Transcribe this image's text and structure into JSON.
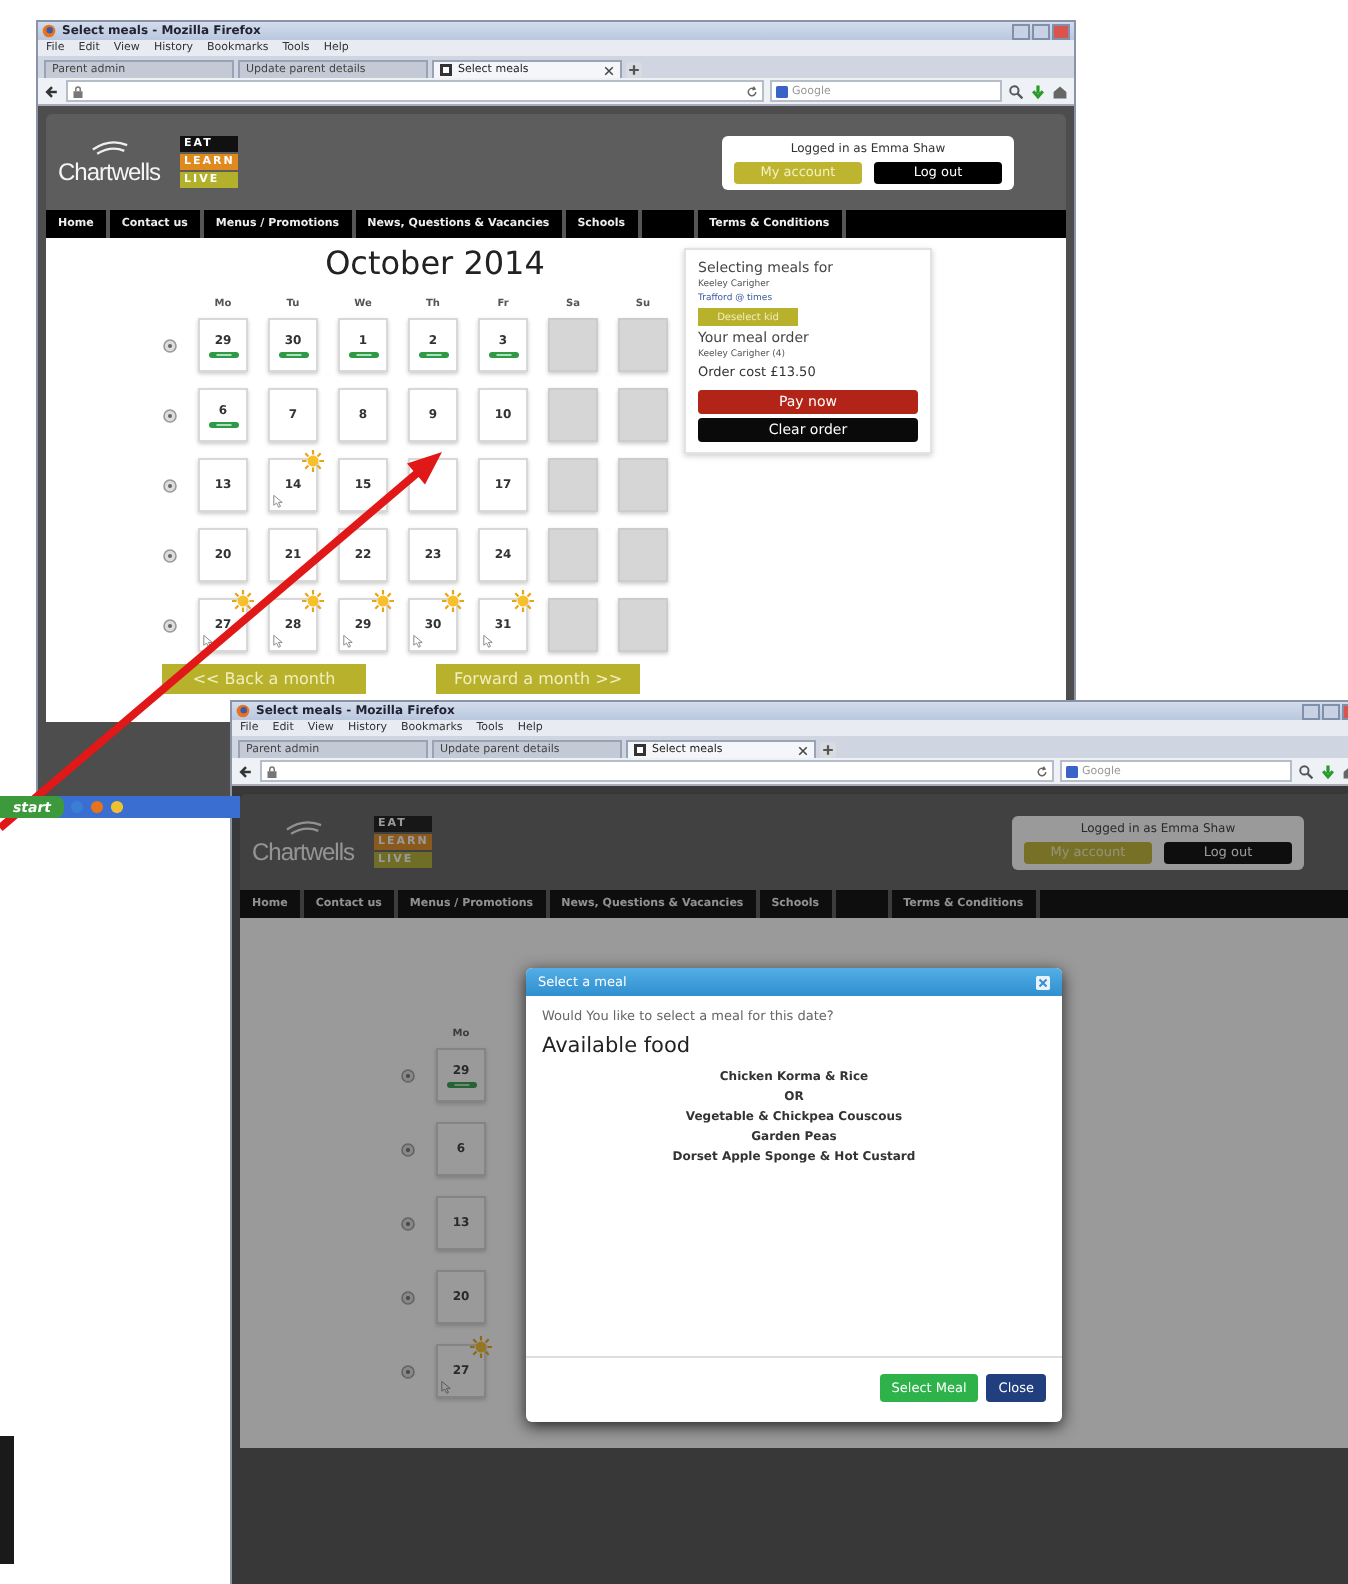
{
  "window_1": {
    "title": "Select meals - Mozilla Firefox",
    "menu": [
      "File",
      "Edit",
      "View",
      "History",
      "Bookmarks",
      "Tools",
      "Help"
    ],
    "tabs": [
      {
        "label": "Parent admin",
        "selected": false
      },
      {
        "label": "Update parent details",
        "selected": false
      },
      {
        "label": "Select meals",
        "selected": true
      }
    ],
    "search": {
      "placeholder": "Google"
    },
    "page": {
      "logo": "Chartwells",
      "tagline": [
        "EAT",
        "LEARN",
        "LIVE"
      ],
      "login": {
        "status": "Logged in as Emma Shaw",
        "buttons": [
          "My account",
          "Log out"
        ]
      },
      "nav": [
        "Home",
        "Contact us",
        "Menus / Promotions",
        "News, Questions & Vacancies",
        "Schools",
        "Terms & Conditions"
      ],
      "calendar": {
        "title": "October 2014",
        "weekdays": [
          "Mo",
          "Tu",
          "We",
          "Th",
          "Fr",
          "Sa",
          "Su"
        ],
        "weeks": [
          {
            "days": [
              {
                "day": "29",
                "kind": "ordered"
              },
              {
                "day": "30",
                "kind": "ordered"
              },
              {
                "day": "1",
                "kind": "ordered"
              },
              {
                "day": "2",
                "kind": "ordered"
              },
              {
                "day": "3",
                "kind": "ordered"
              },
              {
                "kind": "closed"
              },
              {
                "kind": "closed"
              }
            ]
          },
          {
            "days": [
              {
                "day": "6",
                "kind": "ordered"
              },
              {
                "day": "7",
                "kind": "open"
              },
              {
                "day": "8",
                "kind": "open"
              },
              {
                "day": "9",
                "kind": "open"
              },
              {
                "day": "10",
                "kind": "open"
              },
              {
                "kind": "closed"
              },
              {
                "kind": "closed"
              }
            ]
          },
          {
            "days": [
              {
                "day": "13",
                "kind": "open"
              },
              {
                "day": "14",
                "kind": "available"
              },
              {
                "day": "15",
                "kind": "open"
              },
              {
                "kind": "hidden"
              },
              {
                "day": "17",
                "kind": "open"
              },
              {
                "kind": "closed"
              },
              {
                "kind": "closed"
              }
            ]
          },
          {
            "days": [
              {
                "day": "20",
                "kind": "open"
              },
              {
                "day": "21",
                "kind": "open"
              },
              {
                "day": "22",
                "kind": "open"
              },
              {
                "day": "23",
                "kind": "open"
              },
              {
                "day": "24",
                "kind": "open"
              },
              {
                "kind": "closed"
              },
              {
                "kind": "closed"
              }
            ]
          },
          {
            "days": [
              {
                "day": "27",
                "kind": "available"
              },
              {
                "day": "28",
                "kind": "available"
              },
              {
                "day": "29",
                "kind": "available"
              },
              {
                "day": "30",
                "kind": "available"
              },
              {
                "day": "31",
                "kind": "available"
              },
              {
                "kind": "closed"
              },
              {
                "kind": "closed"
              }
            ]
          }
        ],
        "back": "<< Back a month",
        "forward": "Forward a month >>"
      },
      "sidebar": {
        "heading": "Selecting meals for",
        "child": "Keeley Carigher",
        "school": "Trafford @ times",
        "change": "Deselect kid",
        "order_heading": "Your meal order",
        "order_line": "Keeley Carigher (4)",
        "cost": "Order cost £13.50",
        "pay": "Pay now",
        "clear": "Clear order"
      }
    }
  },
  "taskbar": {
    "start": "start"
  },
  "window_2": {
    "title": "Select meals - Mozilla Firefox",
    "menu": [
      "File",
      "Edit",
      "View",
      "History",
      "Bookmarks",
      "Tools",
      "Help"
    ],
    "tabs": [
      {
        "label": "Parent admin",
        "selected": false
      },
      {
        "label": "Update parent details",
        "selected": false
      },
      {
        "label": "Select meals",
        "selected": true
      }
    ],
    "search": {
      "placeholder": "Google"
    },
    "page": {
      "logo": "Chartwells",
      "tagline": [
        "EAT",
        "LEARN",
        "LIVE"
      ],
      "login": {
        "status": "Logged in as Emma Shaw",
        "buttons": [
          "My account",
          "Log out"
        ]
      },
      "nav": [
        "Home",
        "Contact us",
        "Menus / Promotions",
        "News, Questions & Vacancies",
        "Schools",
        "Terms & Conditions"
      ],
      "calendar": {
        "weekdays": [
          "Mo"
        ],
        "weeks": [
          {
            "days": [
              {
                "day": "29",
                "kind": "ordered"
              }
            ]
          },
          {
            "days": [
              {
                "day": "6",
                "kind": "open"
              }
            ]
          },
          {
            "days": [
              {
                "day": "13",
                "kind": "open"
              }
            ]
          },
          {
            "days": [
              {
                "day": "20",
                "kind": "open"
              }
            ]
          },
          {
            "days": [
              {
                "day": "27",
                "kind": "available"
              }
            ]
          }
        ]
      }
    },
    "modal": {
      "title": "Select a meal",
      "question": "Would You like to select a meal for this date?",
      "heading": "Available food",
      "items": [
        "Chicken Korma & Rice",
        "OR",
        "Vegetable & Chickpea Couscous",
        "Garden Peas",
        "Dorset Apple Sponge & Hot Custard"
      ],
      "buttons": [
        "Select Meal",
        "Close"
      ]
    }
  }
}
